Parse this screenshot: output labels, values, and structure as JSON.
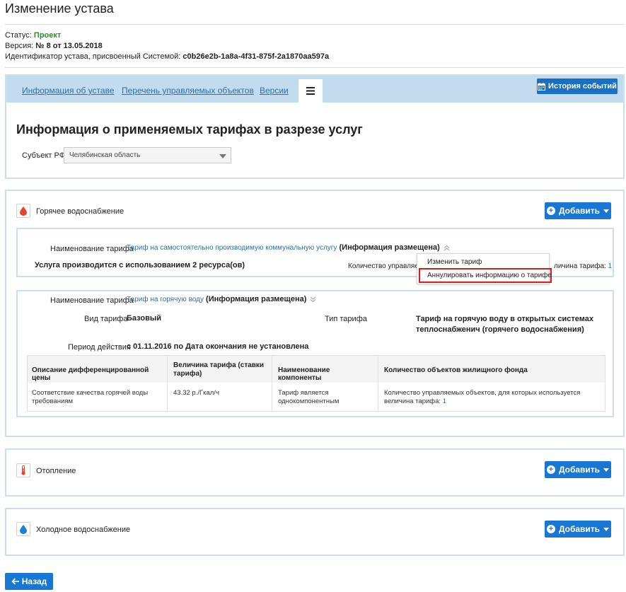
{
  "page": {
    "title": "Изменение устава",
    "status_label": "Статус:",
    "status_value": "Проект",
    "version_label": "Версия:",
    "version_value": "№ 8 от 13.05.2018",
    "identifier_label": "Идентификатор устава, присвоенный Системой:",
    "identifier_value": "c0b26e2b-1a8a-4f31-875f-2a1870aa597a"
  },
  "tabs": [
    {
      "label": "Информация об уставе"
    },
    {
      "label": "Перечень управляемых объектов"
    },
    {
      "label": "Версии"
    },
    {
      "label": "≡",
      "icon": "list-icon",
      "active": true
    }
  ],
  "history_button": {
    "label": "История событий",
    "icon": "calendar-icon"
  },
  "info": {
    "heading": "Информация о применяемых тарифах в разрезе услуг",
    "subject_label": "Субъект РФ",
    "subject_value": "Челябинская область"
  },
  "sections": {
    "hot_water": {
      "title": "Горячее водоснабжение",
      "icon": "water-drop-icon",
      "icon_color": "#e8432b",
      "add_label": "Добавить"
    },
    "heating": {
      "title": "Отопление",
      "icon": "thermometer-icon",
      "icon_color": "#e8432b",
      "add_label": "Добавить"
    },
    "cold_water": {
      "title": "Холодное водоснабжение",
      "icon": "water-drop-icon",
      "icon_color": "#1e7fd6",
      "add_label": "Добавить"
    }
  },
  "tariff1": {
    "name_label": "Наименование тарифа",
    "name_link": "Тариф на самостоятельно производимую коммунальную услугу",
    "status": "(Информация размещена)",
    "service_text": "Услуга производится с использованием 2 ресурса(ов)",
    "objects_label": "Количество управляемых",
    "value_label": "личина тарифа:",
    "value_count": "1",
    "menu": {
      "edit": "Изменить тариф",
      "annul": "Аннулировать информацию о тарифе"
    }
  },
  "tariff2": {
    "name_label": "Наименование тарифа",
    "name_link": "Тариф на горячую воду",
    "status": "(Информация размещена)",
    "kind_label": "Вид тарифа",
    "kind_value": "Базовый",
    "type_label": "Тип тарифа",
    "type_value": "Тариф на горячую воду в открытых системах теплоснабженич (горячего водоснабжения)",
    "period_label": "Период действия",
    "period_value": "с 01.11.2016 по Дата окончания не установлена",
    "table": {
      "headers": [
        "Описание дифференцированной цены",
        "Величина тарифа (ставки тарифа)",
        "Наименование компоненты",
        "Количество объектов жилищного фонда"
      ],
      "row": {
        "desc": "Соответствие качества горячей воды требованиям",
        "value": "43.32 р./Гкал/ч",
        "component": "Тариф является однокомпонентным",
        "objects_text": "Количество управляемых объектов, для которых используется величина тарифа:",
        "objects_count": "1"
      }
    }
  },
  "back_button": {
    "label": "Назад"
  },
  "colors": {
    "accent": "#1877d2",
    "tab_bar": "#c3dbef",
    "panel_border": "#c8dff0",
    "status_green": "#2e8b2e",
    "highlight_red": "#e0191b"
  }
}
